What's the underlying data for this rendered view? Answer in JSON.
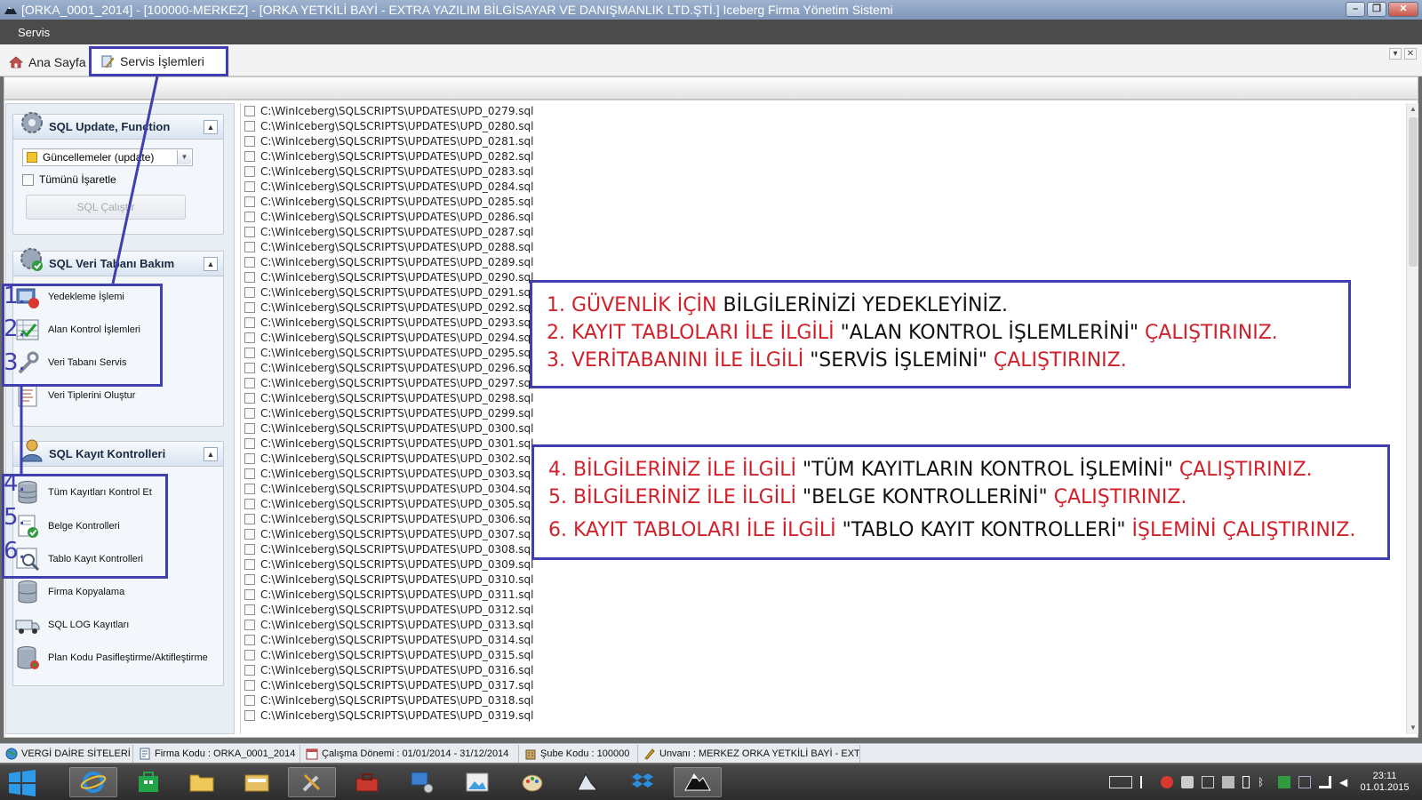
{
  "window": {
    "title": "[ORKA_0001_2014]   -   [100000-MERKEZ]   -   [ORKA YETKİLİ BAYİ - EXTRA YAZILIM BİLGİSAYAR VE DANIŞMANLIK LTD.ŞTİ.]          Iceberg Firma Yönetim Sistemi",
    "minimize": "–",
    "restore": "❐",
    "close": "✕"
  },
  "menu": {
    "servis": "Servis"
  },
  "tabs": {
    "home": "Ana Sayfa",
    "service": "Servis İşlemleri"
  },
  "tab_controls": {
    "dropdown": "▾",
    "close": "✕"
  },
  "left": {
    "group1": {
      "title": "SQL Update, Function",
      "combo_value": "Güncellemeler (update)",
      "check_all": "Tümünü İşaretle",
      "run_button": "SQL Çalıştır"
    },
    "group2": {
      "title": "SQL Veri Tabanı Bakım",
      "items": [
        "Yedekleme İşlemi",
        "Alan Kontrol İşlemleri",
        "Veri Tabanı Servis",
        "Veri Tiplerini Oluştur"
      ]
    },
    "group3": {
      "title": "SQL Kayıt Kontrolleri",
      "items": [
        "Tüm Kayıtları Kontrol Et",
        "Belge Kontrolleri",
        "Tablo Kayıt Kontrolleri",
        "Firma Kopyalama",
        "SQL LOG Kayıtları",
        "Plan Kodu Pasifleştirme/Aktifleştirme"
      ]
    },
    "numbers": [
      "1.",
      "2.",
      "3.",
      "4.",
      "5.",
      "6."
    ]
  },
  "files": [
    "C:\\WinIceberg\\SQLSCRIPTS\\UPDATES\\UPD_0279.sql",
    "C:\\WinIceberg\\SQLSCRIPTS\\UPDATES\\UPD_0280.sql",
    "C:\\WinIceberg\\SQLSCRIPTS\\UPDATES\\UPD_0281.sql",
    "C:\\WinIceberg\\SQLSCRIPTS\\UPDATES\\UPD_0282.sql",
    "C:\\WinIceberg\\SQLSCRIPTS\\UPDATES\\UPD_0283.sql",
    "C:\\WinIceberg\\SQLSCRIPTS\\UPDATES\\UPD_0284.sql",
    "C:\\WinIceberg\\SQLSCRIPTS\\UPDATES\\UPD_0285.sql",
    "C:\\WinIceberg\\SQLSCRIPTS\\UPDATES\\UPD_0286.sql",
    "C:\\WinIceberg\\SQLSCRIPTS\\UPDATES\\UPD_0287.sql",
    "C:\\WinIceberg\\SQLSCRIPTS\\UPDATES\\UPD_0288.sql",
    "C:\\WinIceberg\\SQLSCRIPTS\\UPDATES\\UPD_0289.sql",
    "C:\\WinIceberg\\SQLSCRIPTS\\UPDATES\\UPD_0290.sql",
    "C:\\WinIceberg\\SQLSCRIPTS\\UPDATES\\UPD_0291.sql",
    "C:\\WinIceberg\\SQLSCRIPTS\\UPDATES\\UPD_0292.sql",
    "C:\\WinIceberg\\SQLSCRIPTS\\UPDATES\\UPD_0293.sql",
    "C:\\WinIceberg\\SQLSCRIPTS\\UPDATES\\UPD_0294.sql",
    "C:\\WinIceberg\\SQLSCRIPTS\\UPDATES\\UPD_0295.sql",
    "C:\\WinIceberg\\SQLSCRIPTS\\UPDATES\\UPD_0296.sql",
    "C:\\WinIceberg\\SQLSCRIPTS\\UPDATES\\UPD_0297.sql",
    "C:\\WinIceberg\\SQLSCRIPTS\\UPDATES\\UPD_0298.sql",
    "C:\\WinIceberg\\SQLSCRIPTS\\UPDATES\\UPD_0299.sql",
    "C:\\WinIceberg\\SQLSCRIPTS\\UPDATES\\UPD_0300.sql",
    "C:\\WinIceberg\\SQLSCRIPTS\\UPDATES\\UPD_0301.sql",
    "C:\\WinIceberg\\SQLSCRIPTS\\UPDATES\\UPD_0302.sql",
    "C:\\WinIceberg\\SQLSCRIPTS\\UPDATES\\UPD_0303.sql",
    "C:\\WinIceberg\\SQLSCRIPTS\\UPDATES\\UPD_0304.sql",
    "C:\\WinIceberg\\SQLSCRIPTS\\UPDATES\\UPD_0305.sql",
    "C:\\WinIceberg\\SQLSCRIPTS\\UPDATES\\UPD_0306.sql",
    "C:\\WinIceberg\\SQLSCRIPTS\\UPDATES\\UPD_0307.sql",
    "C:\\WinIceberg\\SQLSCRIPTS\\UPDATES\\UPD_0308.sql",
    "C:\\WinIceberg\\SQLSCRIPTS\\UPDATES\\UPD_0309.sql",
    "C:\\WinIceberg\\SQLSCRIPTS\\UPDATES\\UPD_0310.sql",
    "C:\\WinIceberg\\SQLSCRIPTS\\UPDATES\\UPD_0311.sql",
    "C:\\WinIceberg\\SQLSCRIPTS\\UPDATES\\UPD_0312.sql",
    "C:\\WinIceberg\\SQLSCRIPTS\\UPDATES\\UPD_0313.sql",
    "C:\\WinIceberg\\SQLSCRIPTS\\UPDATES\\UPD_0314.sql",
    "C:\\WinIceberg\\SQLSCRIPTS\\UPDATES\\UPD_0315.sql",
    "C:\\WinIceberg\\SQLSCRIPTS\\UPDATES\\UPD_0316.sql",
    "C:\\WinIceberg\\SQLSCRIPTS\\UPDATES\\UPD_0317.sql",
    "C:\\WinIceberg\\SQLSCRIPTS\\UPDATES\\UPD_0318.sql",
    "C:\\WinIceberg\\SQLSCRIPTS\\UPDATES\\UPD_0319.sql"
  ],
  "notes": {
    "box1": [
      [
        {
          "t": "1. GÜVENLİK İÇİN ",
          "c": "red"
        },
        {
          "t": "BİLGİLERİNİZİ YEDEKLEYİNİZ.",
          "c": "blk"
        }
      ],
      [
        {
          "t": "2. KAYIT TABLOLARI İLE İLGİLİ ",
          "c": "red"
        },
        {
          "t": "\"ALAN KONTROL İŞLEMLERİNİ\" ",
          "c": "blk"
        },
        {
          "t": "ÇALIŞTIRINIZ.",
          "c": "red"
        }
      ],
      [
        {
          "t": "3. VERİTABANINI İLE İLGİLİ ",
          "c": "red"
        },
        {
          "t": "\"SERVİS İŞLEMİNİ\" ",
          "c": "blk"
        },
        {
          "t": "ÇALIŞTIRINIZ.",
          "c": "red"
        }
      ]
    ],
    "box2": [
      [
        {
          "t": "4. BİLGİLERİNİZ İLE İLGİLİ ",
          "c": "red"
        },
        {
          "t": "\"TÜM KAYITLARIN KONTROL İŞLEMİNİ\" ",
          "c": "blk"
        },
        {
          "t": "ÇALIŞTIRINIZ.",
          "c": "red"
        }
      ],
      [
        {
          "t": "5. BİLGİLERİNİZ İLE İLGİLİ ",
          "c": "red"
        },
        {
          "t": "\"BELGE KONTROLLERİNİ\" ",
          "c": "blk"
        },
        {
          "t": "ÇALIŞTIRINIZ.",
          "c": "red"
        }
      ],
      [
        {
          "t": "6. KAYIT TABLOLARI İLE İLGİLİ ",
          "c": "red"
        },
        {
          "t": "\"TABLO KAYIT KONTROLLERİ\" ",
          "c": "blk"
        },
        {
          "t": "İŞLEMİNİ ÇALIŞTIRINIZ.",
          "c": "red"
        }
      ]
    ]
  },
  "status": {
    "tax": "VERGİ DAİRE SİTELERİ",
    "company": "Firma Kodu : ORKA_0001_2014",
    "period": "Çalışma Dönemi : 01/01/2014 - 31/12/2014",
    "branch": "Şube Kodu : 100000",
    "title": "Unvanı : MERKEZ ORKA YETKİLİ BAYİ - EXTRA Y"
  },
  "taskbar": {
    "time": "23:11",
    "date": "01.01.2015"
  },
  "colors": {
    "annotation_blue": "#3f3fb0",
    "annotation_red": "#d0212b",
    "menubar": "#4b4b4b"
  },
  "icons": {
    "app": "iceberg-app-icon",
    "home": "home-icon",
    "service": "service-icon",
    "group1": "gear-icon",
    "group2": "gear-check-icon",
    "group3": "user-icon"
  }
}
